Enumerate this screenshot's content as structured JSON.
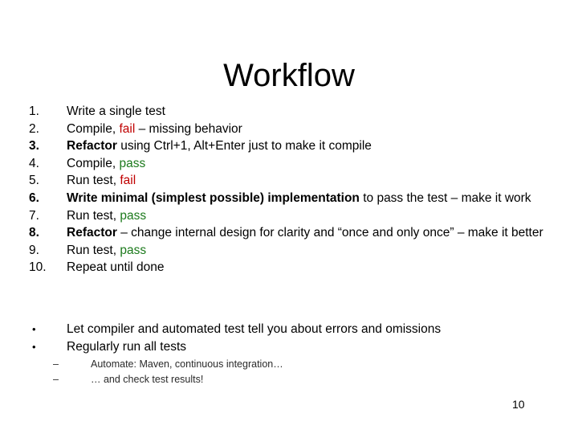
{
  "slide": {
    "title": "Workflow",
    "page_number": "10",
    "colors": {
      "fail": "#c00000",
      "pass": "#1c7a1c",
      "text": "#000000",
      "background": "#ffffff"
    },
    "numbered_items": [
      {
        "marker": "1.",
        "marker_bold": false,
        "parts": [
          {
            "text": "Write a single test",
            "style": "normal"
          }
        ]
      },
      {
        "marker": "2.",
        "marker_bold": false,
        "parts": [
          {
            "text": "Compile, ",
            "style": "normal"
          },
          {
            "text": "fail",
            "style": "fail"
          },
          {
            "text": " – missing behavior",
            "style": "normal"
          }
        ]
      },
      {
        "marker": "3.",
        "marker_bold": true,
        "parts": [
          {
            "text": "Refactor",
            "style": "bold"
          },
          {
            "text": " using Ctrl+1, Alt+Enter just to make it compile",
            "style": "normal"
          }
        ]
      },
      {
        "marker": "4.",
        "marker_bold": false,
        "parts": [
          {
            "text": "Compile, ",
            "style": "normal"
          },
          {
            "text": "pass",
            "style": "pass"
          }
        ]
      },
      {
        "marker": "5.",
        "marker_bold": false,
        "parts": [
          {
            "text": "Run test, ",
            "style": "normal"
          },
          {
            "text": "fail",
            "style": "fail"
          }
        ]
      },
      {
        "marker": "6.",
        "marker_bold": true,
        "parts": [
          {
            "text": "Write minimal (simplest possible) implementation",
            "style": "bold"
          },
          {
            "text": " to pass the test – make it work",
            "style": "normal"
          }
        ]
      },
      {
        "marker": "7.",
        "marker_bold": false,
        "parts": [
          {
            "text": "Run test, ",
            "style": "normal"
          },
          {
            "text": "pass",
            "style": "pass"
          }
        ]
      },
      {
        "marker": "8.",
        "marker_bold": true,
        "parts": [
          {
            "text": "Refactor",
            "style": "bold"
          },
          {
            "text": " – change internal design for clarity and “once and only once” – make it better",
            "style": "normal"
          }
        ]
      },
      {
        "marker": "9.",
        "marker_bold": false,
        "parts": [
          {
            "text": "Run test, ",
            "style": "normal"
          },
          {
            "text": "pass",
            "style": "pass"
          }
        ]
      },
      {
        "marker": "10.",
        "marker_bold": false,
        "parts": [
          {
            "text": "Repeat until done",
            "style": "normal"
          }
        ]
      }
    ],
    "bullet_items": [
      {
        "marker": "•",
        "text": "Let compiler and automated test tell you about errors and omissions"
      },
      {
        "marker": "•",
        "text": "Regularly run all tests"
      }
    ],
    "sub_items": [
      {
        "marker": "–",
        "text": "Automate: Maven, continuous integration…"
      },
      {
        "marker": "–",
        "text": "… and check test results!"
      }
    ]
  }
}
